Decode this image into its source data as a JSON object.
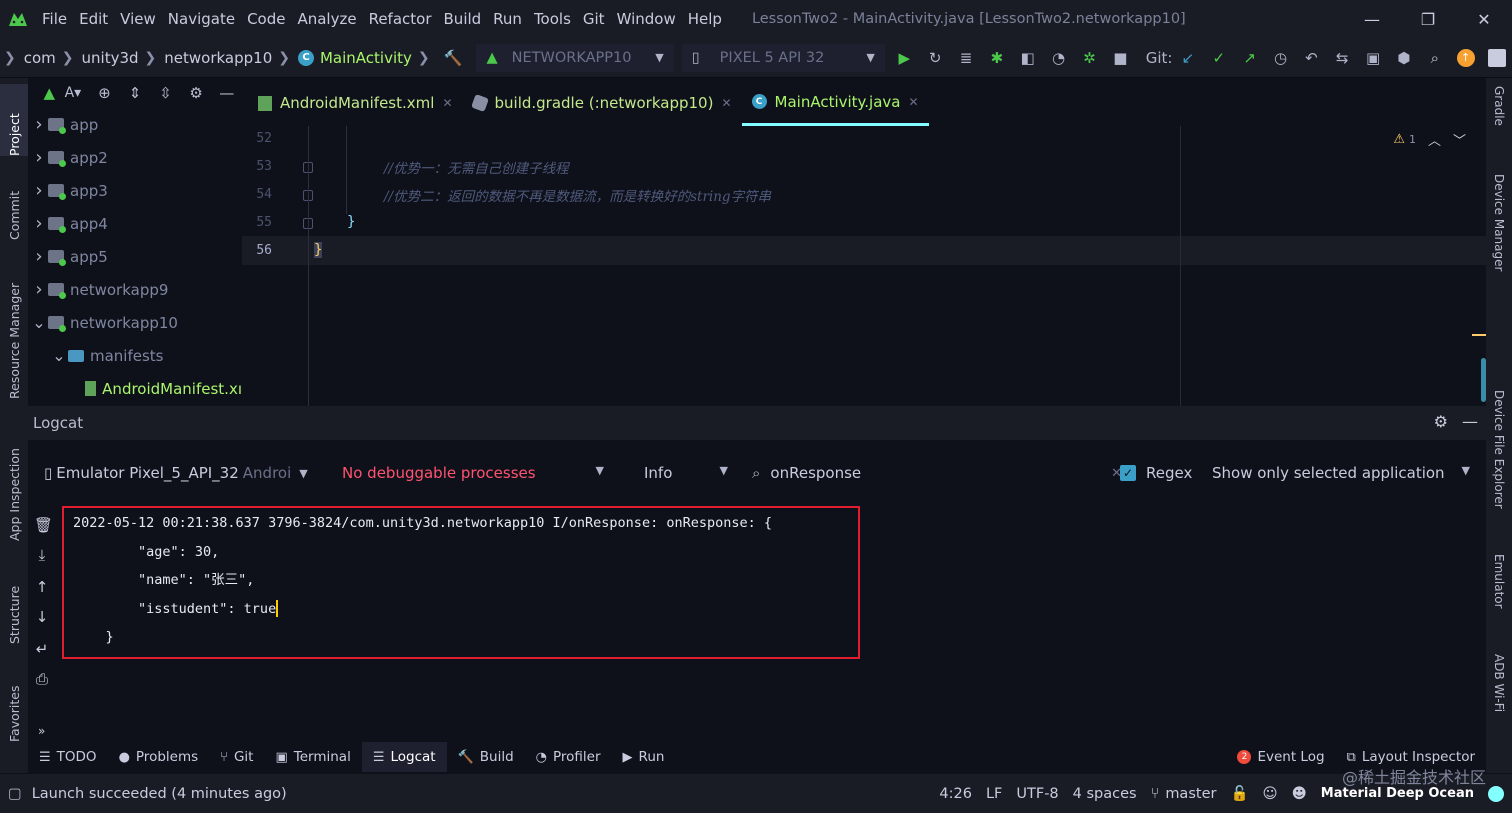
{
  "menubar": {
    "items": [
      "File",
      "Edit",
      "View",
      "Navigate",
      "Code",
      "Analyze",
      "Refactor",
      "Build",
      "Run",
      "Tools",
      "Git",
      "Window",
      "Help"
    ],
    "title": "LessonTwo2 - MainActivity.java [LessonTwo2.networkapp10]"
  },
  "navbar": {
    "crumbs": [
      "com",
      "unity3d",
      "networkapp10",
      "MainActivity"
    ],
    "run_config": "NETWORKAPP10",
    "device": "PIXEL 5 API 32",
    "git_label": "Git:"
  },
  "left_tabs": {
    "project": "Project",
    "commit": "Commit",
    "resource_manager": "Resource Manager",
    "app_inspection": "App Inspection",
    "structure": "Structure",
    "favorites": "Favorites"
  },
  "right_tabs": {
    "gradle": "Gradle",
    "device_manager": "Device Manager",
    "device_file_explorer": "Device File Explorer",
    "emulator": "Emulator",
    "adb_wifi": "ADB Wi-Fi"
  },
  "project": {
    "toolbar_label": "A▾",
    "tree": [
      {
        "label": "app",
        "type": "module",
        "depth": 0,
        "expanded": false
      },
      {
        "label": "app2",
        "type": "module",
        "depth": 0,
        "expanded": false
      },
      {
        "label": "app3",
        "type": "module",
        "depth": 0,
        "expanded": false
      },
      {
        "label": "app4",
        "type": "module",
        "depth": 0,
        "expanded": false
      },
      {
        "label": "app5",
        "type": "module",
        "depth": 0,
        "expanded": false
      },
      {
        "label": "networkapp9",
        "type": "module",
        "depth": 0,
        "expanded": false
      },
      {
        "label": "networkapp10",
        "type": "module",
        "depth": 0,
        "expanded": true
      },
      {
        "label": "manifests",
        "type": "folder",
        "depth": 1,
        "expanded": true
      },
      {
        "label": "AndroidManifest.xı",
        "type": "xml",
        "depth": 2,
        "expanded": false
      }
    ]
  },
  "editor": {
    "tabs": [
      {
        "label": "AndroidManifest.xml",
        "icon": "xml-file-icon",
        "active": false
      },
      {
        "label": "build.gradle (:networkapp10)",
        "icon": "gradle-icon",
        "active": false
      },
      {
        "label": "MainActivity.java",
        "icon": "class-icon",
        "active": true
      }
    ],
    "line_numbers": [
      "52",
      "53",
      "54",
      "55",
      "56"
    ],
    "comment1": "//优势一：无需自己创建子线程",
    "comment2": "//优势二：返回的数据不再是数据流，而是转换好的string字符串",
    "brace_inner": "}",
    "brace_outer": "}",
    "warning_count": "1"
  },
  "logcat": {
    "title": "Logcat",
    "device": "Emulator Pixel_5_API_32",
    "device_suffix": "Androi",
    "process": "No debuggable processes",
    "level": "Info",
    "search": "onResponse",
    "regex_label": "Regex",
    "show_filter": "Show only selected application",
    "lines": [
      "2022-05-12 00:21:38.637 3796-3824/com.unity3d.networkapp10 I/onResponse: onResponse: {",
      "        \"age\": 30,",
      "        \"name\": \"张三\",",
      "        \"isstudent\": true",
      "    }"
    ]
  },
  "toolwindows": {
    "left": [
      "TODO",
      "Problems",
      "Git",
      "Terminal",
      "Logcat",
      "Build",
      "Profiler",
      "Run"
    ],
    "event_log": "Event Log",
    "event_count": "2",
    "layout_inspector": "Layout Inspector"
  },
  "status": {
    "message": "Launch succeeded (4 minutes ago)",
    "position": "4:26",
    "line_sep": "LF",
    "encoding": "UTF-8",
    "indent": "4 spaces",
    "branch": "master",
    "theme": "Material Deep Ocean"
  },
  "watermark": "@稀土掘金技术社区",
  "colors": {
    "accent": "#84ffff",
    "string_green": "#a9f56b",
    "error_red": "#ff5370",
    "highlight_box": "#e01e2e"
  }
}
